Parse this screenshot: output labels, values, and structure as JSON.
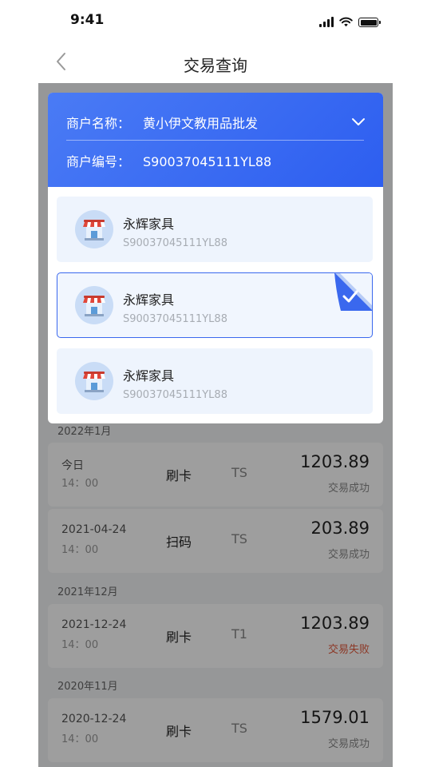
{
  "status_bar": {
    "time": "9:41"
  },
  "nav": {
    "title": "交易查询"
  },
  "merchant_panel": {
    "name_label": "商户名称：",
    "name_value": "黄小伊文教用品批发",
    "code_label": "商户编号：",
    "code_value": "S90037045111YL88",
    "items": [
      {
        "name": "永辉家具",
        "code": "S90037045111YL88",
        "selected": false
      },
      {
        "name": "永辉家具",
        "code": "S90037045111YL88",
        "selected": true
      },
      {
        "name": "永辉家具",
        "code": "S90037045111YL88",
        "selected": false
      }
    ]
  },
  "transactions": {
    "groups": [
      {
        "month": "2022年1月",
        "rows": [
          {
            "date": "今日",
            "time": "14：00",
            "method": "刷卡",
            "settle": "TS",
            "amount": "1203.89",
            "status": "交易成功"
          },
          {
            "date": "2021-04-24",
            "time": "14：00",
            "method": "扫码",
            "settle": "TS",
            "amount": "203.89",
            "status": "交易成功"
          }
        ]
      },
      {
        "month": "2021年12月",
        "rows": [
          {
            "date": "2021-12-24",
            "time": "14：00",
            "method": "刷卡",
            "settle": "T1",
            "amount": "1203.89",
            "status": "交易失败"
          }
        ]
      },
      {
        "month": "2020年11月",
        "rows": [
          {
            "date": "2020-12-24",
            "time": "14：00",
            "method": "刷卡",
            "settle": "TS",
            "amount": "1579.01",
            "status": "交易成功"
          }
        ]
      }
    ]
  },
  "colors": {
    "accent": "#3a68ee",
    "header_gradient_start": "#4a7bf5",
    "header_gradient_end": "#2d5ef0",
    "success_text": "#888888",
    "fail_text": "#e25a3d"
  }
}
